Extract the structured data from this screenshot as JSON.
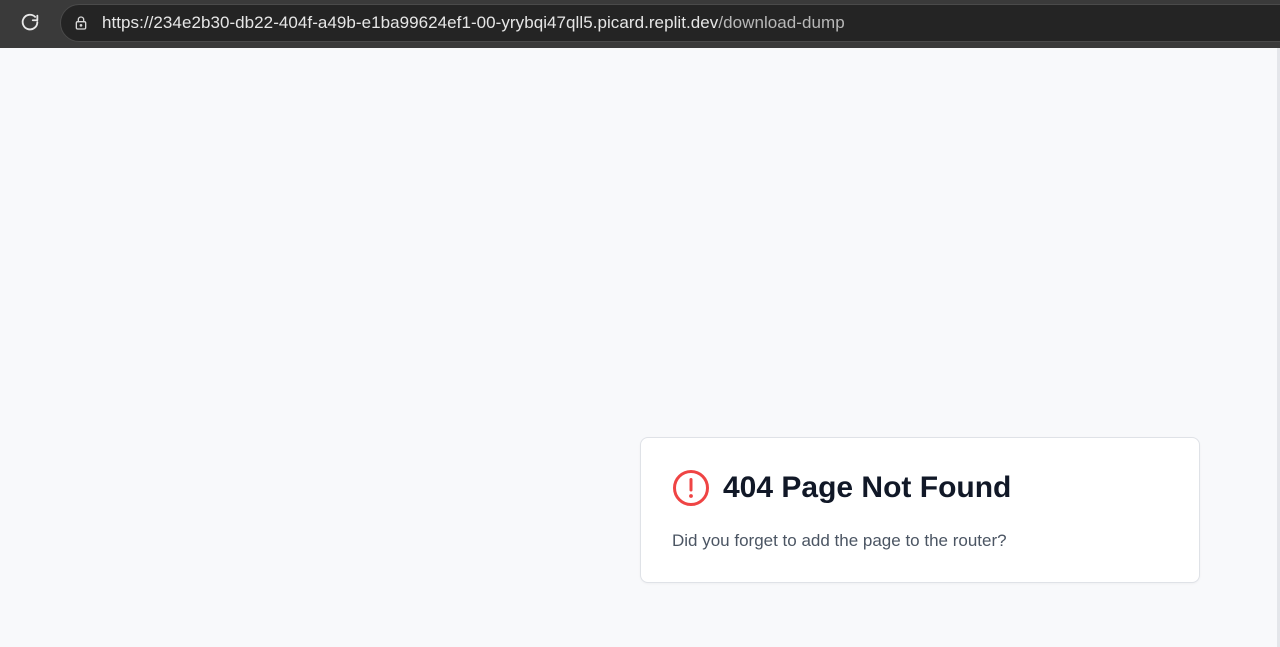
{
  "browser": {
    "url_base": "https://234e2b30-db22-404f-a49b-e1ba99624ef1-00-yrybqi47qll5.picard.replit.dev",
    "url_path": "/download-dump",
    "reload_icon": "reload-icon",
    "lock_icon": "lock-icon"
  },
  "error_card": {
    "title": "404 Page Not Found",
    "message": "Did you forget to add the page to the router?",
    "icon": "alert-circle-icon",
    "accent_color": "#ef4444"
  }
}
